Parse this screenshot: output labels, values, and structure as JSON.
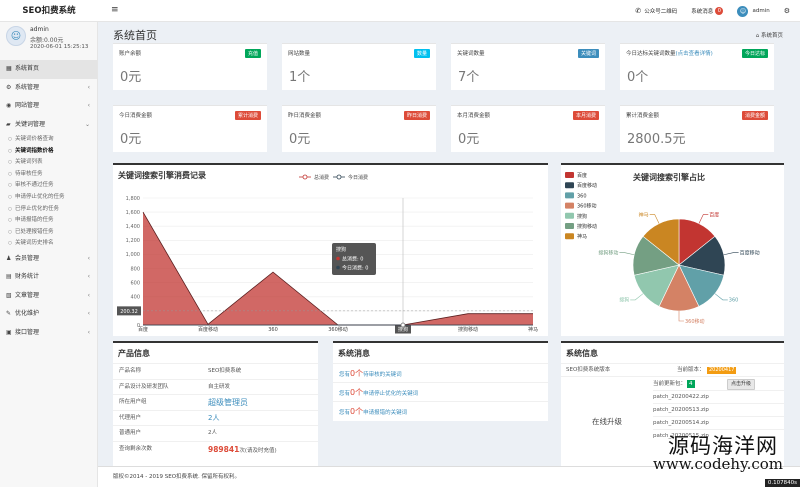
{
  "brand": "SEO扣费系统",
  "topbar": {
    "wechat": "公众号二维码",
    "messages": "系统消息",
    "messages_count": "0",
    "user": "admin"
  },
  "user_panel": {
    "name": "admin",
    "balance": "余额:0.00元",
    "time": "2020-06-01 15:25:13"
  },
  "nav": {
    "home": "系统首页",
    "sysmgmt": "系统管理",
    "sitemgmt": "网站管理",
    "kwmgmt": "关键词管理",
    "sub": [
      "关键词价格查询",
      "关键词指数价格",
      "关键词列表",
      "待审核任务",
      "审核不通过任务",
      "申请停止优化的任务",
      "已停止优化的任务",
      "申请报错的任务",
      "已处理报错任务",
      "关键词历史排名"
    ],
    "members": "会员管理",
    "finance": "财务统计",
    "articles": "文章管理",
    "optimize": "优化维护",
    "api": "接口管理"
  },
  "page": {
    "title": "系统首页",
    "crumb": "系统首页"
  },
  "stats_row1": [
    {
      "label": "账户余额",
      "tag": "充值",
      "value": "0元",
      "color": "#00a65a"
    },
    {
      "label": "网站数量",
      "tag": "数量",
      "value": "1个",
      "color": "#00c0ef"
    },
    {
      "label": "关键词数量",
      "tag": "关键词",
      "value": "7个",
      "color": "#3c8dbc"
    },
    {
      "label": "今日达标关键词数量",
      "label_sub": "(点击查看详情)",
      "tag": "今日达标",
      "value": "0个",
      "color": "#00a65a"
    }
  ],
  "stats_row2": [
    {
      "label": "今日消费金额",
      "tag": "累计消费",
      "value": "0元",
      "color": "#dd4b39"
    },
    {
      "label": "昨日消费金额",
      "tag": "昨日消费",
      "value": "0元",
      "color": "#dd4b39"
    },
    {
      "label": "本月消费金额",
      "tag": "本月消费",
      "value": "0元",
      "color": "#dd4b39"
    },
    {
      "label": "累计消费金额",
      "tag": "消费金额",
      "value": "2800.5元",
      "color": "#dd4b39"
    }
  ],
  "line_box": {
    "title": "关键词搜索引擎消费记录"
  },
  "pie_box": {
    "title": "关键词搜索引擎占比"
  },
  "chart_data": [
    {
      "type": "area",
      "title": "关键词搜索引擎消费记录",
      "categories": [
        "百度",
        "百度移动",
        "360",
        "360移动",
        "搜狗",
        "搜狗移动",
        "神马"
      ],
      "series": [
        {
          "name": "总消费",
          "values": [
            1600,
            10,
            750,
            0,
            0,
            160,
            160
          ],
          "color": "#c23531"
        },
        {
          "name": "今日消费",
          "values": [
            0,
            0,
            0,
            0,
            0,
            0,
            0
          ],
          "color": "#2f4554"
        }
      ],
      "ylim": [
        0,
        1800
      ],
      "yticks": [
        0,
        200,
        400,
        600,
        800,
        1000,
        1200,
        1400,
        1600,
        1800
      ],
      "ytick_labels": [
        "0",
        "200",
        "400",
        "600",
        "800",
        "1,000",
        "1,200",
        "1,400",
        "1,600",
        "1,800"
      ],
      "axis_pointer": {
        "y_value": "200.32",
        "x_value": "搜狗"
      },
      "tooltip": {
        "title": "搜狗",
        "line1": "总消费: 0",
        "line2": "今日消费: 0"
      },
      "grid": true,
      "legend": "top-right"
    },
    {
      "type": "pie",
      "title": "关键词搜索引擎占比",
      "slices": [
        {
          "name": "百度",
          "value": 1,
          "color": "#c23531"
        },
        {
          "name": "百度移动",
          "value": 1,
          "color": "#2f4554"
        },
        {
          "name": "360",
          "value": 1,
          "color": "#61a0a8"
        },
        {
          "name": "360移动",
          "value": 1,
          "color": "#d48265"
        },
        {
          "name": "搜狗",
          "value": 1,
          "color": "#91c7ae"
        },
        {
          "name": "搜狗移动",
          "value": 1,
          "color": "#749f83"
        },
        {
          "name": "神马",
          "value": 1,
          "color": "#ca8622"
        }
      ],
      "legend": "top-left"
    }
  ],
  "product": {
    "title": "产品信息",
    "rows": [
      {
        "k": "产品名称",
        "v": "SEO扣费系统"
      },
      {
        "k": "产品设计及研发团队",
        "v": "自主研发"
      },
      {
        "k": "所在用户组",
        "v": "超级管理员"
      },
      {
        "k": "代理用户",
        "v": "2人"
      },
      {
        "k": "普通用户",
        "v": "2人"
      },
      {
        "k": "查询剩余次数",
        "v_num": "989841",
        "v_rest": "次(请及时充值)"
      }
    ]
  },
  "messages": {
    "title": "系统消息",
    "rows": [
      {
        "pre": "您有",
        "n": "0个",
        "post": "待审核的关键词"
      },
      {
        "pre": "您有",
        "n": "0个",
        "post": "申请停止优化的关键词"
      },
      {
        "pre": "您有",
        "n": "0个",
        "post": "申请报错的关键词"
      }
    ]
  },
  "sysinfo": {
    "title": "系统信息",
    "version_label": "SEO扣费系统版本",
    "current_label": "当前版本：",
    "current_value": "20200417",
    "new_label": "当前更新包：",
    "new_count": "4",
    "update_btn": "点击升级",
    "online": "在线升级",
    "patches": [
      "patch_20200422.zip",
      "patch_20200513.zip",
      "patch_20200514.zip",
      "patch_20200515.zip"
    ]
  },
  "footer": {
    "text": "版权©2014 - 2019 SEO扣费系统. 保留所有权利。",
    "badge": "0.107840s"
  },
  "watermark": {
    "line1": "源码海洋网",
    "line2": "www.codehy.com"
  }
}
